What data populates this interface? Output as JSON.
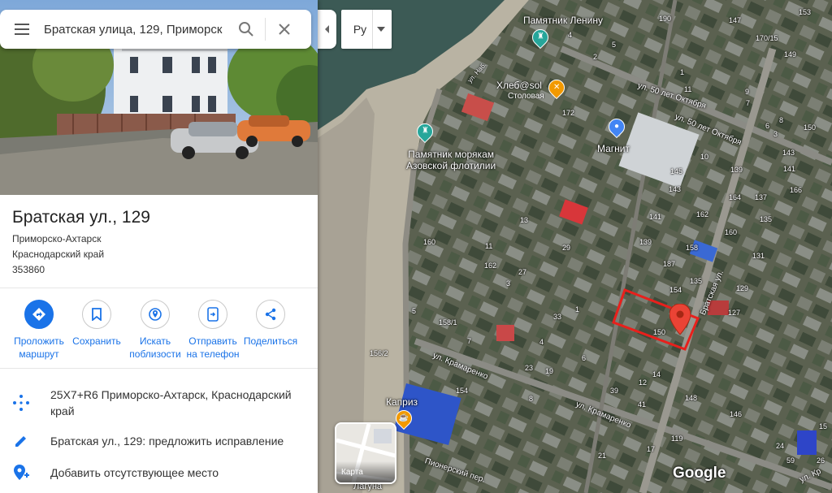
{
  "search": {
    "value": "Братская улица, 129, Приморск"
  },
  "place": {
    "title": "Братская ул., 129",
    "address_lines": [
      "Приморско-Ахтарск",
      "Краснодарский край",
      "353860"
    ]
  },
  "actions": [
    {
      "line1": "Проложить",
      "line2": "маршрут"
    },
    {
      "line1": "Сохранить",
      "line2": ""
    },
    {
      "line1": "Искать",
      "line2": "поблизости"
    },
    {
      "line1": "Отправить",
      "line2": "на телефон"
    },
    {
      "line1": "Поделиться",
      "line2": ""
    }
  ],
  "info": {
    "plus_code": "25X7+R6 Приморско-Ахтарск, Краснодарский край",
    "suggest_edit": "Братская ул., 129: предложить исправление",
    "add_place": "Добавить отсутствующее место"
  },
  "map": {
    "layer_toggle_label": "Ру",
    "thumbnail_label": "Карта",
    "google_logo": "Google",
    "pois": {
      "lenin": "Памятник Ленину",
      "cafe_name": "Хлеб@sol",
      "cafe_sub": "Столовая",
      "magnit": "Магнит",
      "memorial_line1": "Памятник морякам",
      "memorial_line2": "Азовской флотилии",
      "kapriz": "Каприз",
      "laguna": "Лагуна"
    },
    "streets": {
      "oct1": "ул. 50 лет Октября",
      "oct2": "ул. 50 лет Октября",
      "bratskaya": "Братская ул.",
      "kram1": "ул. Крамаренко",
      "kram2": "ул. Крамаренко",
      "pioner": "Пионерский пер.",
      "nab": "ул. Наб.",
      "kr_right": "ул. Кр"
    },
    "house_numbers": [
      {
        "t": "190"
      },
      {
        "t": "147"
      },
      {
        "t": "153"
      },
      {
        "t": "4"
      },
      {
        "t": "5"
      },
      {
        "t": "2"
      },
      {
        "t": "1"
      },
      {
        "t": "170/15"
      },
      {
        "t": "149"
      },
      {
        "t": "11"
      },
      {
        "t": "9"
      },
      {
        "t": "7"
      },
      {
        "t": "172"
      },
      {
        "t": "8"
      },
      {
        "t": "6"
      },
      {
        "t": "3"
      },
      {
        "t": "150"
      },
      {
        "t": "143"
      },
      {
        "t": "10"
      },
      {
        "t": "145"
      },
      {
        "t": "139"
      },
      {
        "t": "141"
      },
      {
        "t": "143"
      },
      {
        "t": "164"
      },
      {
        "t": "137"
      },
      {
        "t": "166"
      },
      {
        "t": "13"
      },
      {
        "t": "141"
      },
      {
        "t": "162"
      },
      {
        "t": "135"
      },
      {
        "t": "160"
      },
      {
        "t": "160"
      },
      {
        "t": "139"
      },
      {
        "t": "158"
      },
      {
        "t": "11"
      },
      {
        "t": "29"
      },
      {
        "t": "187"
      },
      {
        "t": "131"
      },
      {
        "t": "162"
      },
      {
        "t": "27"
      },
      {
        "t": "3"
      },
      {
        "t": "135"
      },
      {
        "t": "154"
      },
      {
        "t": "129"
      },
      {
        "t": "5"
      },
      {
        "t": "33"
      },
      {
        "t": "127"
      },
      {
        "t": "158/1"
      },
      {
        "t": "7"
      },
      {
        "t": "1"
      },
      {
        "t": "150"
      },
      {
        "t": "156/2"
      },
      {
        "t": "4"
      },
      {
        "t": "23"
      },
      {
        "t": "19"
      },
      {
        "t": "6"
      },
      {
        "t": "154"
      },
      {
        "t": "8"
      },
      {
        "t": "12"
      },
      {
        "t": "39"
      },
      {
        "t": "41"
      },
      {
        "t": "14"
      },
      {
        "t": "148"
      },
      {
        "t": "146"
      },
      {
        "t": "119"
      },
      {
        "t": "24"
      },
      {
        "t": "17"
      },
      {
        "t": "59"
      },
      {
        "t": "26"
      },
      {
        "t": "15"
      },
      {
        "t": "21"
      }
    ]
  },
  "colors": {
    "accent": "#1a73e8",
    "marker": "#ea4335",
    "highlight": "#e8201c"
  }
}
